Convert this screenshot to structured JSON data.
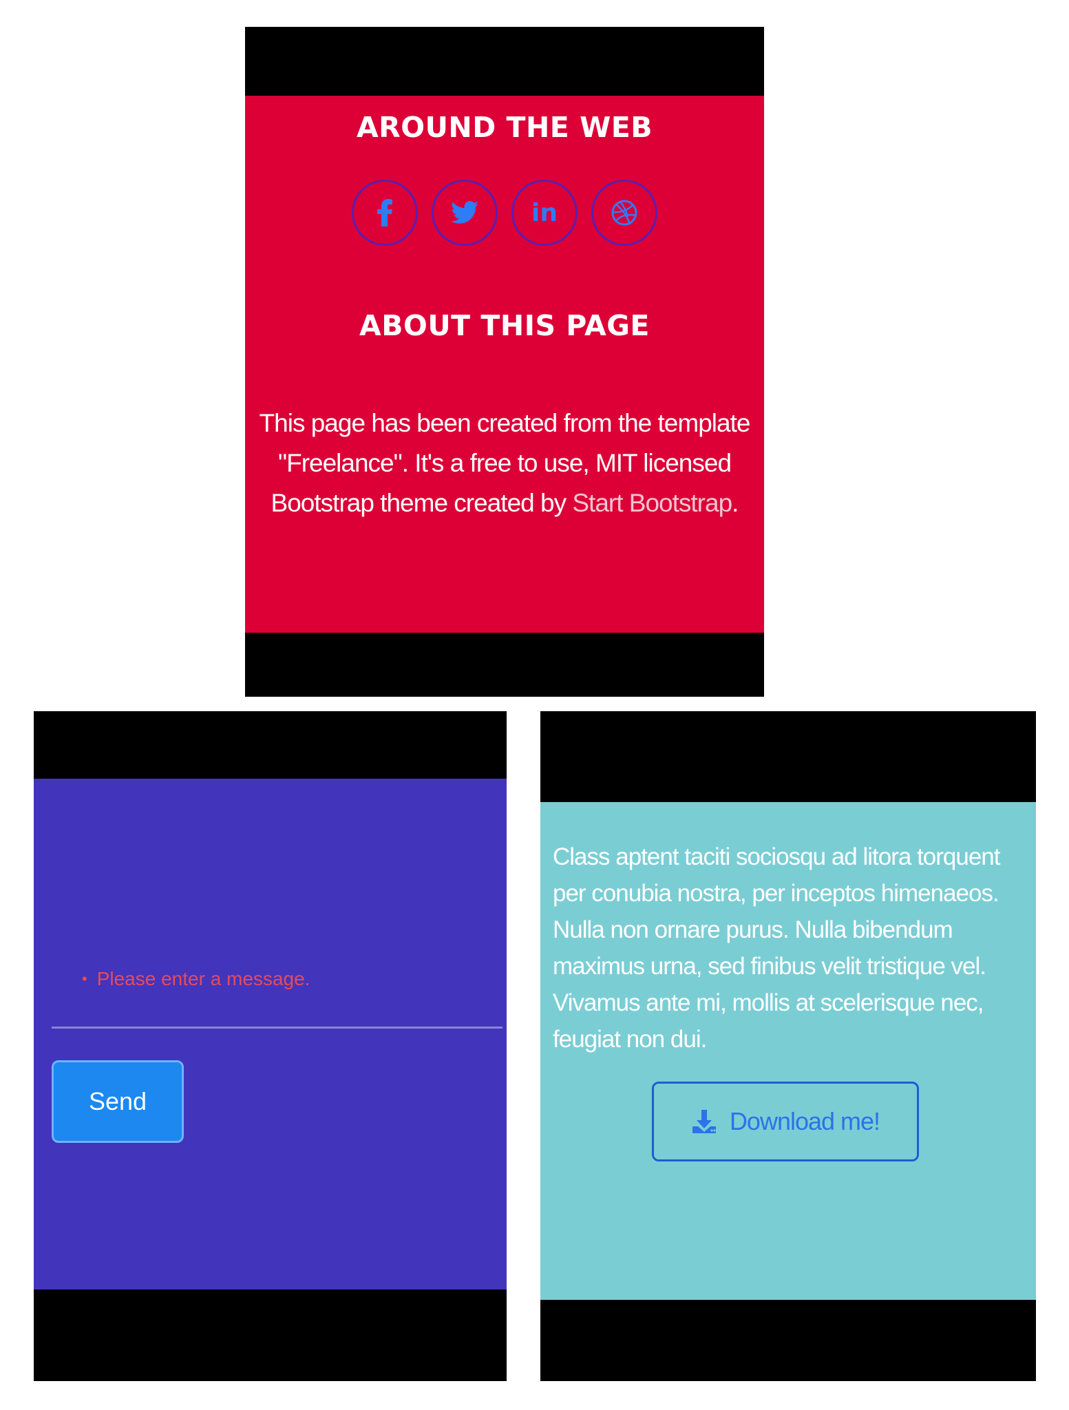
{
  "footer": {
    "around_heading": "AROUND THE WEB",
    "social_links": [
      {
        "icon": "facebook-icon"
      },
      {
        "icon": "twitter-icon"
      },
      {
        "icon": "linkedin-icon",
        "glyph": "in"
      },
      {
        "icon": "dribbble-icon"
      }
    ],
    "about_heading": "ABOUT THIS PAGE",
    "about_text_before": "This page has been created from the template \"Freelance\". It's a free to use, MIT licensed Bootstrap theme created by ",
    "about_link": "Start Bootstrap",
    "about_text_after": "."
  },
  "contact": {
    "error_message": "Please enter a message.",
    "send_label": "Send"
  },
  "about_section": {
    "paragraph": "Class aptent taciti sociosqu ad litora torquent per conubia nostra, per inceptos himenaeos. Nulla non ornare purus. Nulla bibendum maximus urna, sed finibus velit tristique vel. Vivamus ante mi, mollis at scelerisque nec, feugiat non dui.",
    "download_label": "Download me!"
  },
  "colors": {
    "footer_bg": "#dc0037",
    "contact_bg": "#4334bc",
    "about_bg": "#7bcdd4",
    "accent_blue": "#1c88f0",
    "error_red": "#e64b5a"
  }
}
